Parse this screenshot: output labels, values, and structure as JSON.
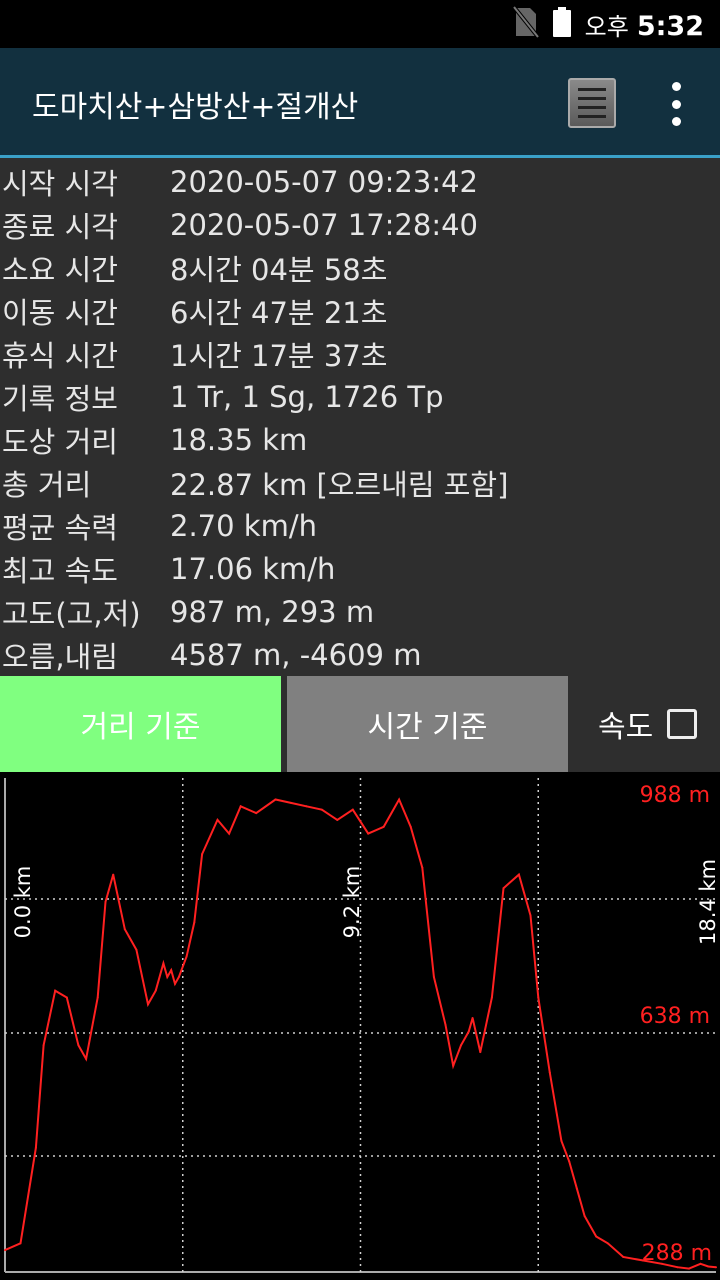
{
  "status_bar": {
    "ampm": "오후",
    "time": "5:32",
    "icons": [
      "no-sim-icon",
      "battery-icon"
    ]
  },
  "app_bar": {
    "title": "도마치산+삼방산+절개산",
    "actions": [
      "list-icon",
      "more-vert-icon"
    ]
  },
  "stats": [
    {
      "label": "시작 시각",
      "value": "2020-05-07 09:23:42"
    },
    {
      "label": "종료 시각",
      "value": "2020-05-07 17:28:40"
    },
    {
      "label": "소요 시간",
      "value": "8시간 04분 58초"
    },
    {
      "label": "이동 시간",
      "value": "6시간 47분 21초"
    },
    {
      "label": "휴식 시간",
      "value": "1시간 17분 37초"
    },
    {
      "label": "기록 정보",
      "value": "1 Tr, 1 Sg, 1726 Tp"
    },
    {
      "label": "도상 거리",
      "value": "18.35 km"
    },
    {
      "label": "총 거리",
      "value": "22.87 km [오르내림 포함]"
    },
    {
      "label": "평균 속력",
      "value": "2.70 km/h"
    },
    {
      "label": "최고 속도",
      "value": "17.06 km/h"
    },
    {
      "label": "고도(고,저)",
      "value": "987 m, 293 m"
    },
    {
      "label": "오름,내림",
      "value": "4587 m, -4609 m"
    }
  ],
  "tabs": {
    "distance_label": "거리 기준",
    "time_label": "시간 기준",
    "distance_color": "#80ff80",
    "time_color": "#808080"
  },
  "speed_toggle": {
    "label": "속도",
    "checked": false
  },
  "chart_data": {
    "type": "line",
    "x_unit": "km",
    "xlim": [
      0,
      18.4
    ],
    "ylim": [
      288,
      988
    ],
    "x_ticks": [
      "0.0 km",
      "9.2 km",
      "18.4 km"
    ],
    "y_ticks": [
      "988 m",
      "638 m",
      "288 m"
    ],
    "line_color": "#ff2020",
    "grid": true,
    "x": [
      0.0,
      0.4,
      0.8,
      1.0,
      1.3,
      1.6,
      1.9,
      2.1,
      2.4,
      2.6,
      2.8,
      3.1,
      3.4,
      3.7,
      3.9,
      4.1,
      4.2,
      4.3,
      4.4,
      4.5,
      4.7,
      4.9,
      5.1,
      5.5,
      5.8,
      6.1,
      6.5,
      7.0,
      7.4,
      7.8,
      8.2,
      8.6,
      9.0,
      9.4,
      9.8,
      10.2,
      10.5,
      10.8,
      11.1,
      11.4,
      11.6,
      11.8,
      12.0,
      12.1,
      12.3,
      12.6,
      12.9,
      13.3,
      13.6,
      13.8,
      14.1,
      14.4,
      14.6,
      14.8,
      15.0,
      15.3,
      15.6,
      16.0,
      16.5,
      17.0,
      17.4,
      17.7,
      18.0,
      18.2,
      18.4
    ],
    "y": [
      320,
      330,
      470,
      620,
      700,
      690,
      620,
      600,
      690,
      830,
      870,
      790,
      760,
      680,
      700,
      740,
      720,
      730,
      710,
      720,
      750,
      800,
      900,
      950,
      930,
      970,
      960,
      980,
      975,
      970,
      965,
      950,
      965,
      930,
      940,
      980,
      940,
      880,
      720,
      650,
      590,
      620,
      640,
      660,
      610,
      690,
      850,
      870,
      810,
      690,
      580,
      480,
      450,
      410,
      370,
      340,
      330,
      310,
      305,
      300,
      295,
      293,
      300,
      296,
      295
    ]
  }
}
